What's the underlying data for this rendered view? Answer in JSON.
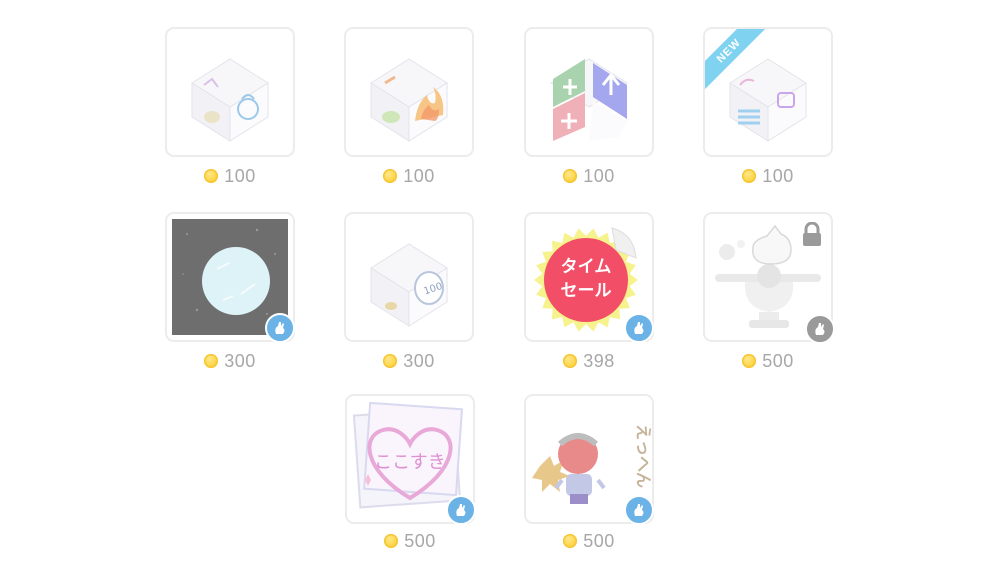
{
  "items": [
    {
      "price": "100",
      "art": "dice-character-icon",
      "new": false
    },
    {
      "price": "100",
      "art": "dice-fire-icon",
      "new": false
    },
    {
      "price": "100",
      "art": "dice-compass-icon",
      "new": false
    },
    {
      "price": "100",
      "art": "dice-anata-icon",
      "new": true,
      "new_label": "NEW"
    },
    {
      "price": "300",
      "art": "moon-effect-icon",
      "badge": "blue"
    },
    {
      "price": "300",
      "art": "dice-coin-icon"
    },
    {
      "price": "398",
      "art": "time-sale-sticker",
      "sticker_text_1": "タイム",
      "sticker_text_2": "セール",
      "badge": "blue"
    },
    {
      "price": "500",
      "art": "cat-trophy-icon",
      "badge": "gray",
      "locked": true
    },
    {
      "price": "500",
      "art": "heart-frame-icon",
      "frame_text": "ここすき",
      "badge": "blue"
    },
    {
      "price": "500",
      "art": "tengu-icon",
      "tengu_text": "えっへん",
      "badge": "blue"
    }
  ],
  "colors": {
    "coin": "#ffd54a",
    "price_text": "#a7a7a7",
    "badge_blue": "#6bb3e6",
    "badge_gray": "#9a9a9a",
    "new_ribbon": "#7fd3f0",
    "card_border": "#ececec"
  }
}
